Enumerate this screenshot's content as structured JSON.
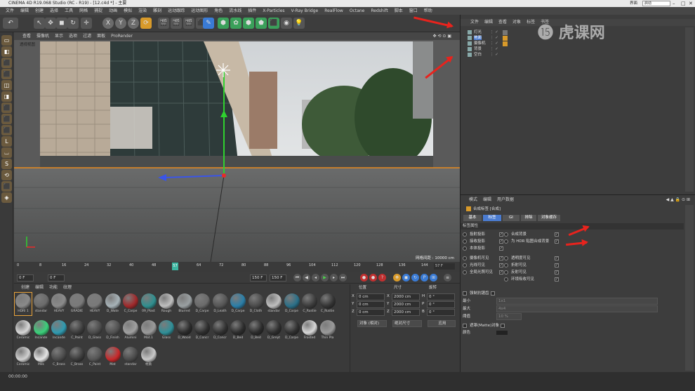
{
  "window": {
    "title": "CINEMA 4D R19.068 Studio (RC - R19) - [12.c4d *] - 主要",
    "layout_label": "界面",
    "layout_value": "启动"
  },
  "menubar": [
    "文件",
    "编辑",
    "创建",
    "选择",
    "工具",
    "网格",
    "捕捉",
    "动画",
    "模拟",
    "渲染",
    "雕刻",
    "运动跟踪",
    "运动图形",
    "角色",
    "流水线",
    "插件",
    "X-Particles",
    "V-Ray Bridge",
    "RealFlow",
    "Octane",
    "Redshift",
    "脚本",
    "窗口",
    "帮助"
  ],
  "toolbar": {
    "undo": "↶",
    "items": [
      "↖",
      "✥",
      "◼",
      "↻",
      "✛",
      "X",
      "Y",
      "Z",
      "⟳",
      "🎬",
      "🎬",
      "🎬",
      "⬛",
      "✎",
      "⬢",
      "✿",
      "⬢",
      "⬟",
      "⬛",
      "◉",
      "💡"
    ]
  },
  "left_tools": [
    "▭",
    "◧",
    "⬛",
    "⬛",
    "◫",
    "◨",
    "⬛",
    "⬛",
    "⬛",
    "L",
    "⌴",
    "S",
    "⟲",
    "⬛",
    "◈"
  ],
  "viewport": {
    "menu": [
      "查看",
      "摄像机",
      "显示",
      "选项",
      "过滤",
      "面板",
      "ProRender"
    ],
    "label": "透视视图",
    "grid_spacing": "网格间距 : 10000 cm",
    "colors": {
      "axis_y": "#2fd12f",
      "axis_x": "#3a55e8",
      "horizon": "#e88a1e"
    }
  },
  "timeline": {
    "ticks": [
      "0",
      "8",
      "16",
      "24",
      "32",
      "40",
      "48",
      "56",
      "64",
      "72",
      "80",
      "88",
      "96",
      "104",
      "112",
      "120",
      "128",
      "136",
      "144"
    ],
    "current_marker": "57",
    "end_label": "57 F"
  },
  "playbar": {
    "start": "0 F",
    "start2": "0 F",
    "end": "150 F",
    "end2": "150 F"
  },
  "materials": {
    "tabs": [
      "创建",
      "编辑",
      "功能",
      "纹理"
    ],
    "items": [
      {
        "label": "HDRI 1",
        "color": "#8a8a8a"
      },
      {
        "label": "standar",
        "color": "#6a6a6a"
      },
      {
        "label": "HEAVY",
        "color": "#8a8a8a"
      },
      {
        "label": "GRADIE",
        "color": "#7a7a7a"
      },
      {
        "label": "HEAVY",
        "color": "#7a7a7a"
      },
      {
        "label": "D_Wate",
        "color": "#a7b3b8"
      },
      {
        "label": "C_Carpe",
        "color": "#a0282a"
      },
      {
        "label": "09_Plast",
        "color": "#2f8f8f"
      },
      {
        "label": "Rough",
        "color": "#c0c0c0"
      },
      {
        "label": "Blurred",
        "color": "#9aa0a2"
      },
      {
        "label": "D_Carpe",
        "color": "#6a6a6a"
      },
      {
        "label": "D_Leath",
        "color": "#555555"
      },
      {
        "label": "D_Carpe",
        "color": "#2a7ea8"
      },
      {
        "label": "D_Cloth",
        "color": "#4a4a4a"
      },
      {
        "label": "standar",
        "color": "#bfbfbf"
      },
      {
        "label": "D_Carpe",
        "color": "#2a6f88"
      },
      {
        "label": "C_Rustie",
        "color": "#3a3a3a"
      },
      {
        "label": "C_Rustie",
        "color": "#333333"
      },
      {
        "label": "Ceramic",
        "color": "#d8d8d8"
      },
      {
        "label": "Incande",
        "color": "#3ad07a"
      },
      {
        "label": "Incande",
        "color": "#2f9ab0"
      },
      {
        "label": "C_Paint",
        "color": "#3a3a3a"
      },
      {
        "label": "D_Glass",
        "color": "#4a4a4a"
      },
      {
        "label": "D_Finish",
        "color": "#505050"
      },
      {
        "label": "Alumini",
        "color": "#a0a0a0"
      },
      {
        "label": "Mat.1",
        "color": "#9a9a9a"
      },
      {
        "label": "Glass",
        "color": "#2f8f98"
      },
      {
        "label": "D_Wood",
        "color": "#2a2a2a"
      },
      {
        "label": "D_Concr",
        "color": "#2e2e2e"
      },
      {
        "label": "D_Concr",
        "color": "#303030"
      },
      {
        "label": "D_Bed",
        "color": "#2c2c2c"
      },
      {
        "label": "D_Bed",
        "color": "#2b2b2b"
      },
      {
        "label": "D_Greyt",
        "color": "#2e2e2e"
      },
      {
        "label": "D_Carpe",
        "color": "#2f2f2f"
      },
      {
        "label": "Frosted",
        "color": "#d8d8d8"
      },
      {
        "label": "Thin Pla",
        "color": "#9a9a9a"
      },
      {
        "label": "Ceramic",
        "color": "#d0d0d0"
      },
      {
        "label": "Milk",
        "color": "#e5e5e5"
      },
      {
        "label": "C_Brass",
        "color": "#4a4a4a"
      },
      {
        "label": "C_Brass",
        "color": "#3a3a3a"
      },
      {
        "label": "C_Paint",
        "color": "#555555"
      },
      {
        "label": "Mat",
        "color": "#c8282a"
      },
      {
        "label": "standar",
        "color": "#4a4a4a"
      },
      {
        "label": "材质",
        "color": "#c8c8c8"
      }
    ]
  },
  "coords": {
    "headers": [
      "位置",
      "尺寸",
      "旋转"
    ],
    "rows": [
      {
        "axis": "X",
        "pos": "0 cm",
        "size_axis": "X",
        "size": "2000 cm",
        "rot_axis": "H",
        "rot": "0 °"
      },
      {
        "axis": "Y",
        "pos": "0 cm",
        "size_axis": "Y",
        "size": "2000 cm",
        "rot_axis": "P",
        "rot": "0 °"
      },
      {
        "axis": "Z",
        "pos": "0 cm",
        "size_axis": "Z",
        "size": "2000 cm",
        "rot_axis": "B",
        "rot": "0 °"
      }
    ],
    "mode": "对象 (相对)",
    "size_mode": "绝对尺寸",
    "apply": "应用"
  },
  "objects": {
    "menu": [
      "文件",
      "编辑",
      "查看",
      "对象",
      "标签",
      "书签"
    ],
    "items": [
      "灯光",
      "地面",
      "摄像机",
      "背景",
      "空白"
    ]
  },
  "attributes": {
    "menu": [
      "模式",
      "编辑",
      "用户数据"
    ],
    "title": "合成标签 [合成]",
    "tabs": [
      "基本",
      "标签",
      "GI",
      "排除",
      "对象缓存"
    ],
    "section": "标签属性",
    "left_rows": [
      "投射投影",
      "接收投影",
      "本体投影",
      "摄像机可见",
      "光线可见",
      "全局光照可见"
    ],
    "right_rows": [
      "合成背景",
      "为 HDR 贴图合成背景",
      "透明度可见",
      "折射可见",
      "反射可见",
      "环境吸收可见"
    ],
    "extra": [
      "强制抗锯齿",
      "最小",
      "最大",
      "阈值",
      "遮罩(Matte)对象",
      "颜色"
    ],
    "extra_values": [
      "1x1",
      "4x4",
      "10 %"
    ]
  },
  "status": {
    "time": "00:00:00"
  },
  "watermark": "虎课网"
}
